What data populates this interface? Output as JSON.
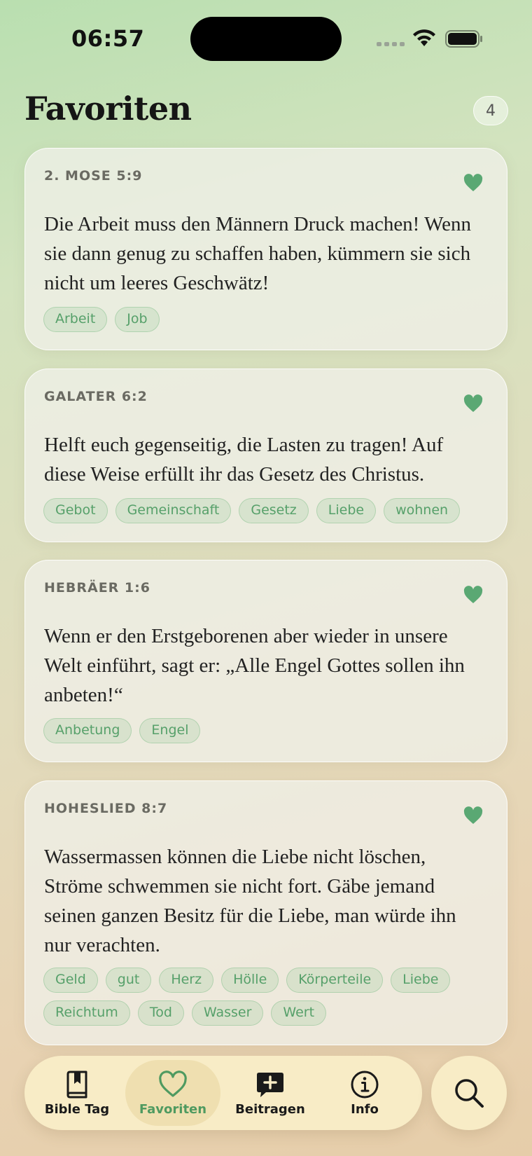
{
  "status_bar": {
    "time": "06:57"
  },
  "header": {
    "title": "Favoriten",
    "count": "4"
  },
  "colors": {
    "accent": "#4f9a60",
    "heart": "#5aa873",
    "tab_bar": "#f8ecc6"
  },
  "cards": [
    {
      "reference": "2. MOSE 5:9",
      "text": "Die Arbeit muss den Männern Druck machen! Wenn sie dann genug zu schaffen haben, kümmern sie sich nicht um leeres Geschwätz!",
      "tags": [
        "Arbeit",
        "Job"
      ]
    },
    {
      "reference": "GALATER 6:2",
      "text": "Helft euch gegenseitig, die Lasten zu tragen! Auf diese Weise erfüllt ihr das Gesetz des Christus.",
      "tags": [
        "Gebot",
        "Gemeinschaft",
        "Gesetz",
        "Liebe",
        "wohnen"
      ]
    },
    {
      "reference": "HEBRÄER 1:6",
      "text": "Wenn er den Erstgeborenen aber wieder in unsere Welt einführt, sagt er: „Alle Engel Gottes sollen ihn anbeten!“",
      "tags": [
        "Anbetung",
        "Engel"
      ]
    },
    {
      "reference": "HOHESLIED 8:7",
      "text": "Wassermassen können die Liebe nicht löschen, Ströme schwemmen sie nicht fort. Gäbe jemand seinen ganzen Besitz für die Liebe, man würde ihn nur verachten.",
      "tags": [
        "Geld",
        "gut",
        "Herz",
        "Hölle",
        "Körperteile",
        "Liebe",
        "Reichtum",
        "Tod",
        "Wasser",
        "Wert"
      ]
    }
  ],
  "tab_bar": {
    "tabs": [
      {
        "label": "Bible Tag",
        "icon": "book-icon"
      },
      {
        "label": "Favoriten",
        "icon": "heart-icon",
        "active": true
      },
      {
        "label": "Beitragen",
        "icon": "add-message-icon"
      },
      {
        "label": "Info",
        "icon": "info-icon"
      }
    ],
    "search_icon": "search-icon"
  }
}
